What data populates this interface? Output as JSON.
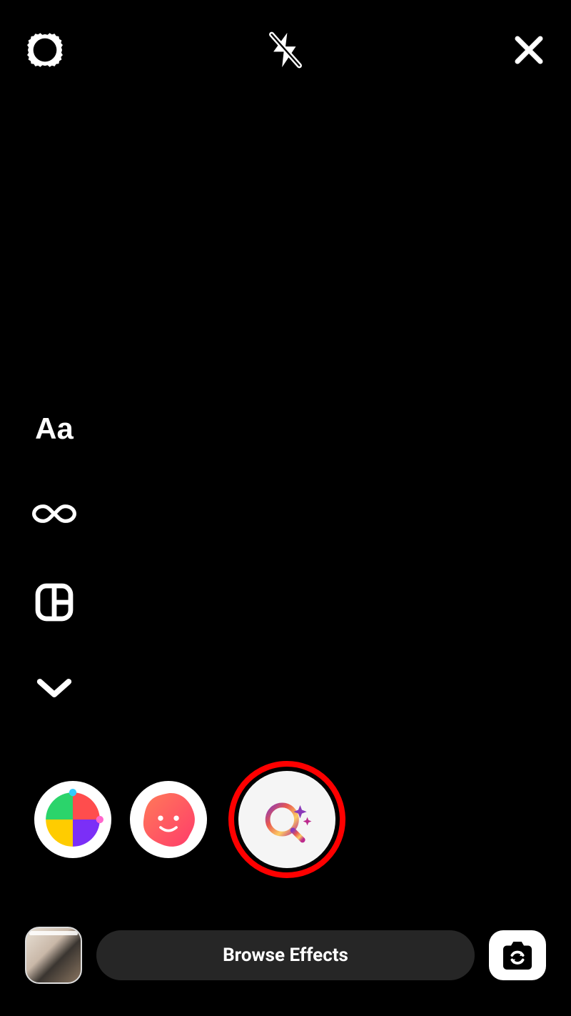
{
  "topbar": {
    "settings_icon": "settings-icon",
    "flash_icon": "flash-off-icon",
    "close_icon": "close-icon"
  },
  "side_tools": {
    "text_label": "Aa",
    "boomerang_icon": "infinity-icon",
    "layout_icon": "layout-icon",
    "more_icon": "chevron-down-icon"
  },
  "effects": {
    "items": [
      {
        "name": "color-filter-effect"
      },
      {
        "name": "blob-face-effect"
      }
    ],
    "capture_icon": "sparkle-search-icon"
  },
  "bottom": {
    "gallery_icon": "gallery-thumbnail",
    "browse_label": "Browse Effects",
    "switch_camera_icon": "camera-switch-icon"
  }
}
